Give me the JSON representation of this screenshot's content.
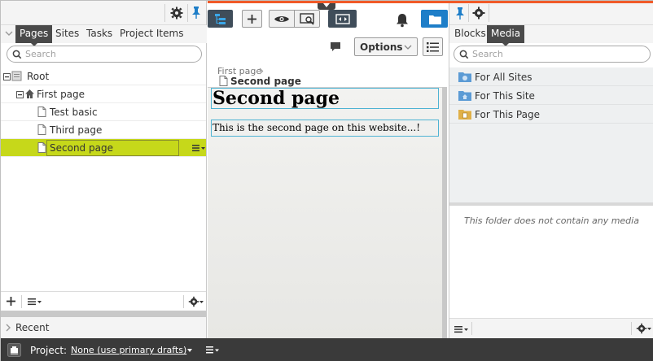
{
  "left_pane": {
    "tabs": [
      {
        "label": "Pages",
        "active": true
      },
      {
        "label": "Sites",
        "active": false
      },
      {
        "label": "Tasks",
        "active": false
      },
      {
        "label": "Project Items",
        "active": false
      }
    ],
    "search_placeholder": "Search",
    "tree": [
      {
        "label": "Root",
        "level": 0,
        "icon": "root-icon",
        "expanded": true
      },
      {
        "label": "First page",
        "level": 1,
        "icon": "home-icon",
        "expanded": true
      },
      {
        "label": "Test basic",
        "level": 2,
        "icon": "page-icon"
      },
      {
        "label": "Third page",
        "level": 2,
        "icon": "page-icon"
      },
      {
        "label": "Second page",
        "level": 2,
        "icon": "page-icon",
        "selected": true
      }
    ],
    "recent_label": "Recent"
  },
  "center": {
    "options_label": "Options",
    "breadcrumb_parent": "First page",
    "breadcrumb_current": "Second page",
    "page_heading": "Second page",
    "page_body": "This is the second page on this website...!"
  },
  "right_pane": {
    "tabs": [
      {
        "label": "Blocks",
        "active": false
      },
      {
        "label": "Media",
        "active": true
      }
    ],
    "search_placeholder": "Search",
    "folders": [
      {
        "label": "For All Sites",
        "icon": "globe-folder-icon"
      },
      {
        "label": "For This Site",
        "icon": "site-folder-icon"
      },
      {
        "label": "For This Page",
        "icon": "page-folder-icon"
      }
    ],
    "empty_message": "This folder does not contain any media"
  },
  "status_bar": {
    "project_label": "Project:",
    "project_value": "None (use primary drafts)"
  },
  "colors": {
    "accent_orange": "#f05a28",
    "selected_row": "#c6d81a",
    "active_blue": "#1e7ec8",
    "dark_tab": "#4a4a4a"
  }
}
